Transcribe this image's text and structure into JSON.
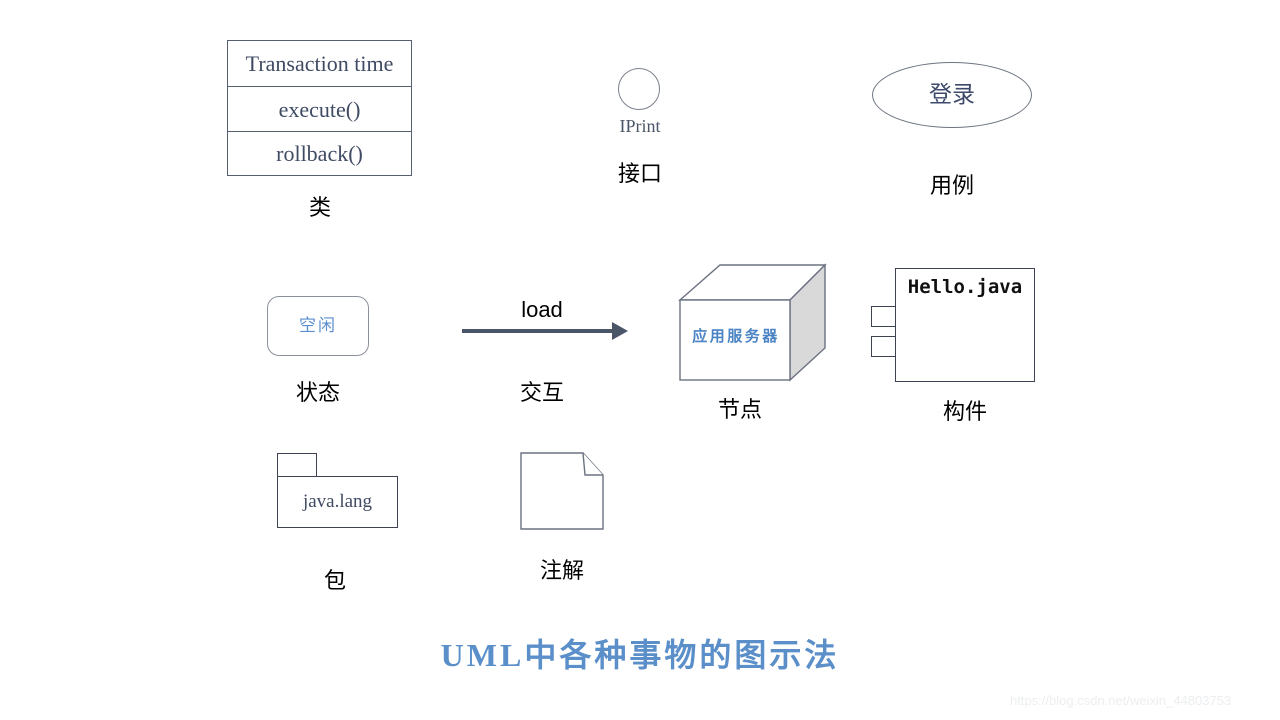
{
  "page": {
    "background": "#ffffff",
    "title": "UML中各种事物的图示法",
    "watermark": "https://blog.csdn.net/weixin_44803753"
  },
  "colors": {
    "title_blue": "#5b8fc9",
    "text_slate": "#3f4a63",
    "steel_blue": "#5b8fd0",
    "node_blue": "#4a84c4",
    "stroke_gray": "#55606e",
    "arrow_gray": "#4a5568",
    "cube_side_fill": "#d9d9d9",
    "watermark_gray": "#eceef0"
  },
  "shapes": {
    "class": {
      "caption": "类",
      "rows": [
        "Transaction time",
        "execute()",
        "rollback()"
      ]
    },
    "interface": {
      "caption": "接口",
      "name": "IPrint",
      "icon": "circle-icon"
    },
    "usecase": {
      "caption": "用例",
      "label": "登录",
      "icon": "ellipse-icon"
    },
    "state": {
      "caption": "状态",
      "label": "空闲"
    },
    "interaction": {
      "caption": "交互",
      "label": "load",
      "icon": "arrow-right-icon"
    },
    "node": {
      "caption": "节点",
      "label": "应用服务器",
      "icon": "cube-icon"
    },
    "component": {
      "caption": "构件",
      "name": "Hello.java",
      "icon": "component-icon"
    },
    "package": {
      "caption": "包",
      "name": "java.lang",
      "icon": "folder-icon"
    },
    "note": {
      "caption": "注解",
      "icon": "note-icon"
    }
  }
}
